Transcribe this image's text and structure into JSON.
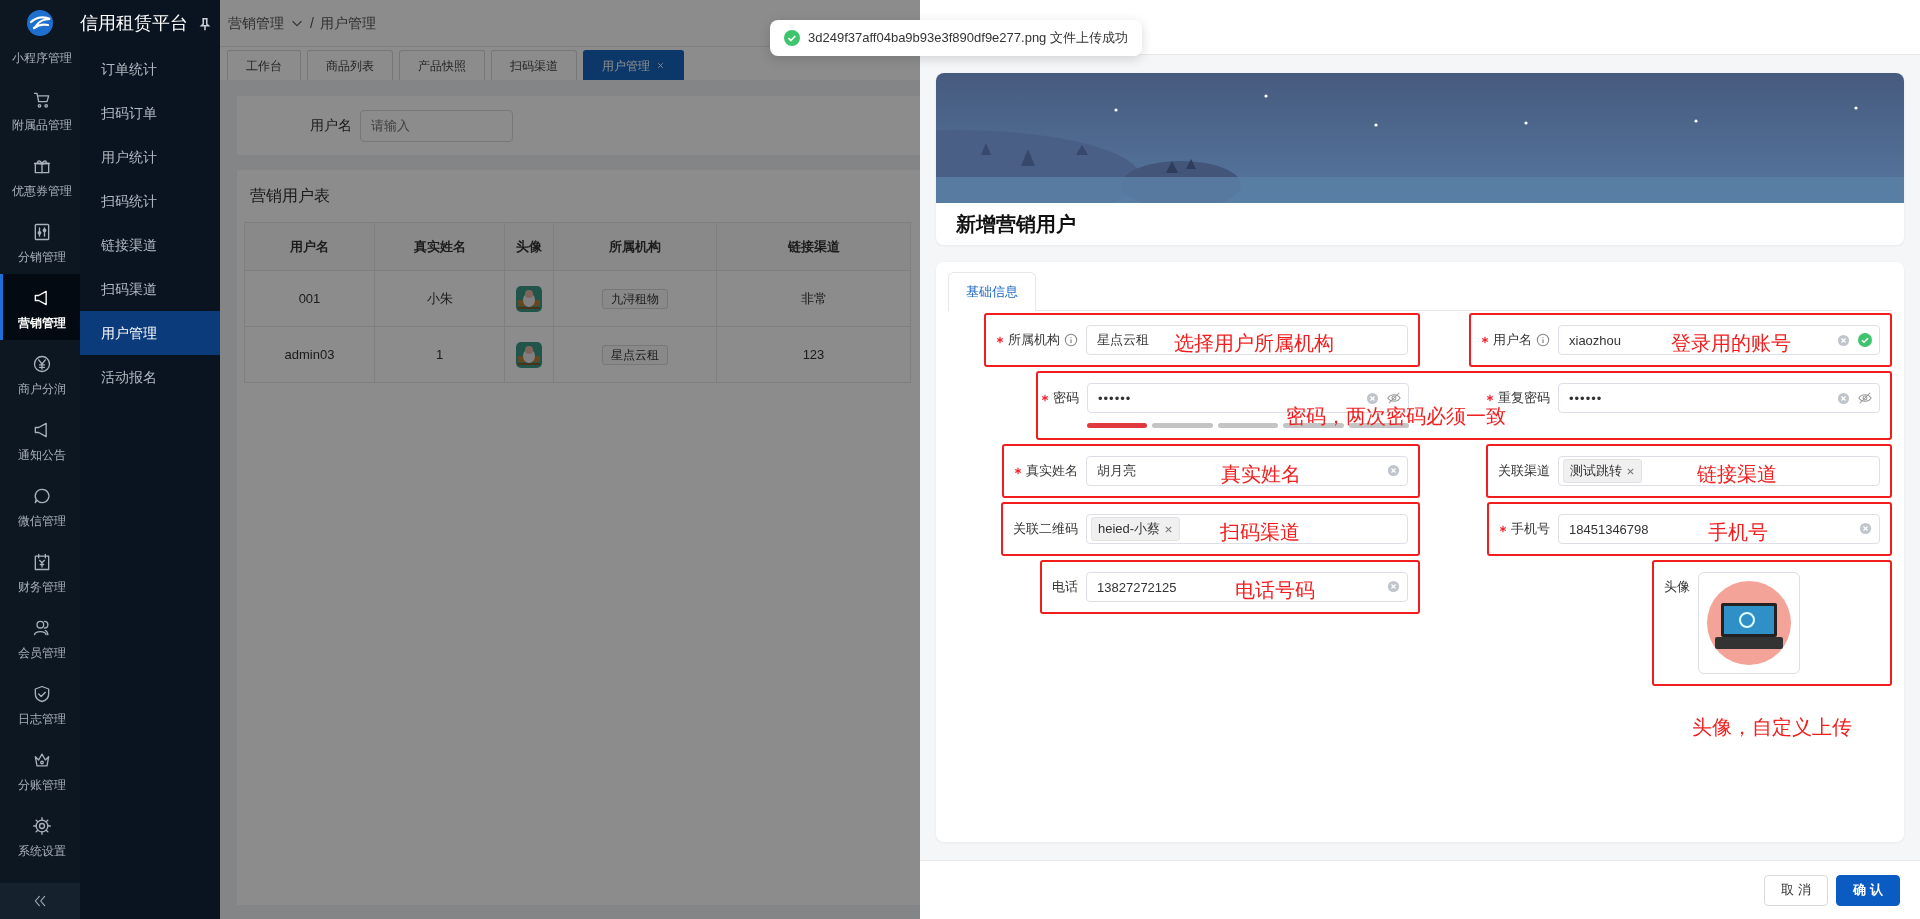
{
  "app": {
    "title": "信用租赁平台"
  },
  "rail": {
    "items": [
      {
        "label": "小程序管理",
        "selected": false
      },
      {
        "label": "附属品管理",
        "selected": false
      },
      {
        "label": "优惠券管理",
        "selected": false
      },
      {
        "label": "分销管理",
        "selected": false
      },
      {
        "label": "营销管理",
        "selected": true
      },
      {
        "label": "商户分润",
        "selected": false
      },
      {
        "label": "通知公告",
        "selected": false
      },
      {
        "label": "微信管理",
        "selected": false
      },
      {
        "label": "财务管理",
        "selected": false
      },
      {
        "label": "会员管理",
        "selected": false
      },
      {
        "label": "日志管理",
        "selected": false
      },
      {
        "label": "分账管理",
        "selected": false
      },
      {
        "label": "系统设置",
        "selected": false
      }
    ]
  },
  "submenu": {
    "items": [
      {
        "label": "订单统计",
        "selected": false
      },
      {
        "label": "扫码订单",
        "selected": false
      },
      {
        "label": "用户统计",
        "selected": false
      },
      {
        "label": "扫码统计",
        "selected": false
      },
      {
        "label": "链接渠道",
        "selected": false
      },
      {
        "label": "扫码渠道",
        "selected": false
      },
      {
        "label": "用户管理",
        "selected": true
      },
      {
        "label": "活动报名",
        "selected": false
      }
    ]
  },
  "breadcrumb": {
    "items": [
      "营销管理",
      "用户管理"
    ],
    "separator": "/"
  },
  "tabs": [
    {
      "label": "工作台",
      "selected": false,
      "closable": false
    },
    {
      "label": "商品列表",
      "selected": false,
      "closable": false
    },
    {
      "label": "产品快照",
      "selected": false,
      "closable": false
    },
    {
      "label": "扫码渠道",
      "selected": false,
      "closable": false
    },
    {
      "label": "用户管理",
      "selected": true,
      "closable": true
    }
  ],
  "search": {
    "label": "用户名",
    "placeholder": "请输入"
  },
  "table": {
    "title": "营销用户表",
    "columns": [
      "用户名",
      "真实姓名",
      "头像",
      "所属机构",
      "链接渠道"
    ],
    "rows": [
      {
        "username": "001",
        "real_name": "小朱",
        "org": "九浔租物",
        "channel": "非常"
      },
      {
        "username": "admin03",
        "real_name": "1",
        "org": "星点云租",
        "channel": "123"
      }
    ]
  },
  "toast": {
    "kind": "success",
    "text": "3d249f37aff04ba9b93e3f890df9e277.png 文件上传成功"
  },
  "drawer": {
    "title": "新增营销用户",
    "tabs": [
      {
        "label": "基础信息",
        "selected": true
      }
    ],
    "form_rows": [
      {
        "groups": [
          {
            "note": "选择用户所属机构",
            "fields": [
              {
                "kind": "text",
                "label": "所属机构",
                "required": true,
                "info": true,
                "value": "星点云租",
                "clearable": false,
                "valid": false
              }
            ]
          },
          {
            "note": "登录用的账号",
            "fields": [
              {
                "kind": "text",
                "label": "用户名",
                "required": true,
                "info": true,
                "value": "xiaozhou",
                "clearable": true,
                "valid": true
              }
            ]
          }
        ]
      },
      {
        "groups": [
          {
            "note": "密码，两次密码必须一致",
            "fields": [
              {
                "kind": "password",
                "label": "密码",
                "required": true,
                "info": false,
                "value": "••••••",
                "clearable": true,
                "valid": false,
                "level": 0.2
              },
              {
                "kind": "password",
                "label": "重复密码",
                "required": true,
                "info": false,
                "value": "••••••",
                "clearable": true,
                "valid": false
              }
            ]
          }
        ]
      },
      {
        "groups": [
          {
            "note": "真实姓名",
            "fields": [
              {
                "kind": "text",
                "label": "真实姓名",
                "required": true,
                "info": false,
                "value": "胡月亮",
                "clearable": true,
                "valid": false
              }
            ]
          },
          {
            "note": "链接渠道",
            "fields": [
              {
                "kind": "tags",
                "label": "关联渠道",
                "required": false,
                "tags": [
                  "测试跳转"
                ]
              }
            ]
          }
        ]
      },
      {
        "groups": [
          {
            "note": "扫码渠道",
            "fields": [
              {
                "kind": "tags",
                "label": "关联二维码",
                "required": false,
                "tags": [
                  "heied-小蔡"
                ]
              }
            ]
          },
          {
            "note": "手机号",
            "fields": [
              {
                "kind": "text",
                "label": "手机号",
                "required": true,
                "info": false,
                "value": "18451346798",
                "clearable": true,
                "valid": false
              }
            ]
          }
        ]
      },
      {
        "groups": [
          {
            "note": "电话号码",
            "fields": [
              {
                "kind": "text",
                "label": "电话",
                "required": false,
                "info": false,
                "value": "13827272125",
                "clearable": true,
                "valid": false
              }
            ]
          },
          {
            "note": "头像，自定义上传",
            "fields": [
              {
                "kind": "upload",
                "label": "头像",
                "required": false
              }
            ]
          }
        ]
      }
    ],
    "buttons": [
      {
        "label": "取 消",
        "kind": "secondary"
      },
      {
        "label": "确 认",
        "kind": "primary"
      }
    ]
  }
}
